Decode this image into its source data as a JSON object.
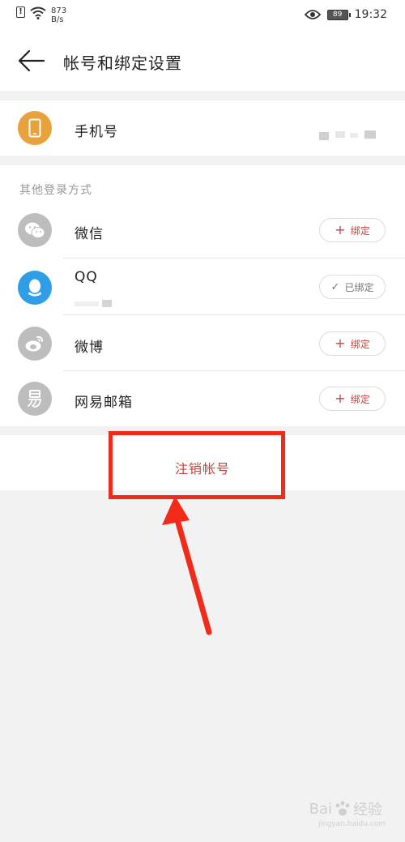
{
  "status_bar": {
    "speed_value": "873",
    "speed_unit": "B/s",
    "battery": "89",
    "time": "19:32"
  },
  "header": {
    "title": "帐号和绑定设置"
  },
  "phone": {
    "label": "手机号"
  },
  "other_login": {
    "section_label": "其他登录方式",
    "items": [
      {
        "label": "微信",
        "button": "绑定",
        "bound": false
      },
      {
        "label": "QQ",
        "button": "已绑定",
        "bound": true
      },
      {
        "label": "微博",
        "button": "绑定",
        "bound": false
      },
      {
        "label": "网易邮箱",
        "button": "绑定",
        "bound": false
      }
    ]
  },
  "logout": {
    "label": "注销帐号"
  },
  "watermark": {
    "brand": "Bai",
    "brand_suffix": "经验",
    "url": "jingyan.baidu.com"
  },
  "colors": {
    "accent_red": "#c9413d",
    "phone_icon_bg": "#e9a23b",
    "qq_icon_bg": "#2f9ee6",
    "gray_icon_bg": "#bdbdbd",
    "annotation_red": "#f12a1a"
  }
}
